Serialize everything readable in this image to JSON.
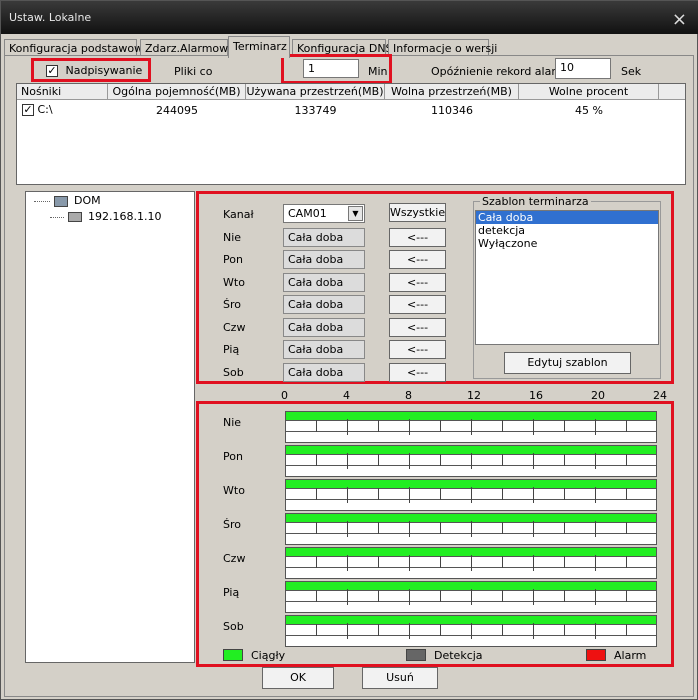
{
  "window": {
    "title": "Ustaw. Lokalne",
    "close_icon": "×"
  },
  "tabs": [
    "Konfiguracja podstawowa",
    "Zdarz.Alarmowe",
    "Terminarz",
    "Konfiguracja DNS",
    "Informacje o wersji"
  ],
  "active_tab": "Terminarz",
  "top_controls": {
    "overwrite_label": "Nadpisywanie",
    "overwrite_checked": true,
    "files_label": "Pliki co",
    "files_value": "1",
    "files_unit": "Min",
    "delay_label": "Opóźnienie rekord alarm",
    "delay_value": "10",
    "delay_unit": "Sek"
  },
  "disks": {
    "columns": [
      "Nośniki",
      "Ogólna pojemność(MB)",
      "Używana przestrzeń(MB)",
      "Wolna przestrzeń(MB)",
      "Wolne procent"
    ],
    "rows": [
      {
        "name": "C:\\",
        "total": "244095",
        "used": "133749",
        "free": "110346",
        "percent": "45 %",
        "checked": true
      }
    ]
  },
  "tree": {
    "root": "DOM",
    "child": "192.168.1.10"
  },
  "schedule": {
    "channel_label": "Kanał",
    "channel_value": "CAM01",
    "all_button": "Wszystkie",
    "arrow_label": "<---",
    "days": [
      {
        "label": "Nie",
        "value": "Cała doba"
      },
      {
        "label": "Pon",
        "value": "Cała doba"
      },
      {
        "label": "Wto",
        "value": "Cała doba"
      },
      {
        "label": "Śro",
        "value": "Cała doba"
      },
      {
        "label": "Czw",
        "value": "Cała doba"
      },
      {
        "label": "Pią",
        "value": "Cała doba"
      },
      {
        "label": "Sob",
        "value": "Cała doba"
      }
    ],
    "template_group_label": "Szablon terminarza",
    "templates": [
      "Cała doba",
      "detekcja",
      "Wyłączone"
    ],
    "selected_template": "Cała doba",
    "edit_template_button": "Edytuj szablon"
  },
  "timeline": {
    "hours": [
      "0",
      "4",
      "8",
      "12",
      "16",
      "20",
      "24"
    ],
    "days": [
      "Nie",
      "Pon",
      "Wto",
      "Śro",
      "Czw",
      "Pią",
      "Sob"
    ],
    "continuous_hours": [
      0,
      24
    ]
  },
  "legend": [
    {
      "label": "Ciągły",
      "color": "#22ee22"
    },
    {
      "label": "Detekcja",
      "color": "#666666"
    },
    {
      "label": "Alarm",
      "color": "#ee1111"
    }
  ],
  "buttons": {
    "ok": "OK",
    "delete": "Usuń"
  }
}
